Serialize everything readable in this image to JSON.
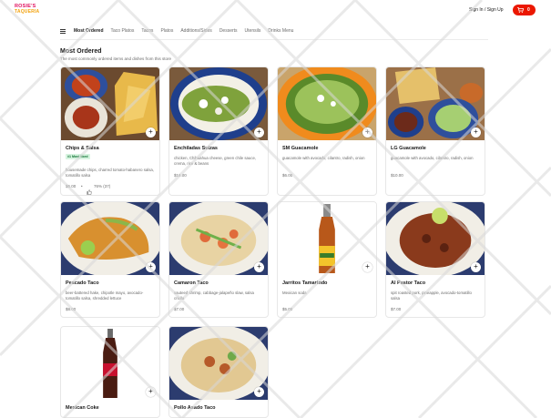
{
  "header": {
    "logo_line1": "ROSIE'S",
    "logo_line2": "TAQUERIA",
    "signin": "Sign In / Sign Up",
    "cart_count": "0",
    "accent": "#eb1700"
  },
  "nav": {
    "tabs": [
      "Most Ordered",
      "Taco Platos",
      "Tacos",
      "Platos",
      "Additions/Sides",
      "Desserts",
      "Utensils",
      "Drinks Menu"
    ],
    "active": "Most Ordered"
  },
  "section": {
    "title": "Most Ordered",
    "subtitle": "The most commonly ordered items and dishes from this store"
  },
  "items": [
    {
      "name": "Chips & Salsa",
      "badge": "#1 Most liked",
      "desc": "housemade chips, charred tomato-habanero salsa, tomatillo salsa",
      "price": "$6.00",
      "sep": "•",
      "rating": "76% (37)"
    },
    {
      "name": "Enchiladas Suizas",
      "desc": "chicken, Chihuahua cheese, green chile sauce, crema, rice & beans",
      "price": "$18.00"
    },
    {
      "name": "SM Guacamole",
      "desc": "guacamole with avocado, cilantro, radish, onion",
      "price": "$6.00"
    },
    {
      "name": "LG Guacamole",
      "desc": "guacamole with avocado, cilantro, radish, onion",
      "price": "$10.00"
    },
    {
      "name": "Pescado Taco",
      "desc": "beer-battered hake, chipotle mayo, avocado-tomatillo salsa, shredded lettuce",
      "price": "$8.00"
    },
    {
      "name": "Camaron Taco",
      "desc": "sauteed shrimp, cabbage-jalapeño slaw, salsa criolla",
      "price": "$7.00"
    },
    {
      "name": "Jarritos Tamarindo",
      "desc": "Mexican soda",
      "price": "$5.00"
    },
    {
      "name": "Al Pastor Taco",
      "desc": "spit roasted pork, pineapple, avocado-tomatillo salsa",
      "price": "$7.00"
    },
    {
      "name": "Mexican Coke",
      "desc": "",
      "price": ""
    },
    {
      "name": "Pollo Asado Taco",
      "desc": "",
      "price": ""
    }
  ],
  "icons": {
    "menu": "hamburger-menu-icon",
    "cart": "cart-icon",
    "add": "plus-icon",
    "thumb": "thumbs-up-icon"
  },
  "add_symbol": "+",
  "watermark": "fiverr."
}
